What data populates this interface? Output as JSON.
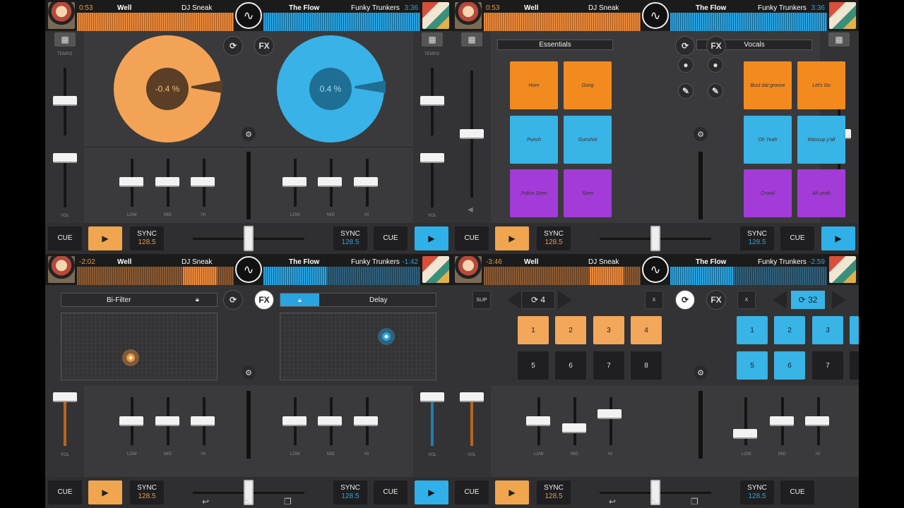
{
  "deck_a": {
    "title": "Well",
    "artist": "DJ Sneak"
  },
  "deck_b": {
    "title": "The Flow",
    "artist": "Funky Trunkers"
  },
  "screens": [
    {
      "left_time": "0:53",
      "right_time": "3:36",
      "left_pitch": "-0.4 %",
      "right_pitch": "0.4 %",
      "left_sync": "128.5",
      "right_sync": "128.5"
    },
    {
      "left_time": "0:53",
      "right_time": "3:36",
      "left_bank": "Essentials",
      "right_bank": "Vocals",
      "left_pads": [
        "Horn",
        "Gong",
        "Punch",
        "Gunshot",
        "Police Siren",
        "Siren"
      ],
      "right_pads": [
        "Bust dat groove",
        "Let's Go",
        "Oh Yeah",
        "Wassup y'all",
        "Crowd",
        "Ah yeah"
      ],
      "left_sync": "128.5",
      "right_sync": "128.5"
    },
    {
      "left_time": "-2:02",
      "right_time": "-1:42",
      "left_fx": "Bi-Filter",
      "right_fx": "Delay",
      "left_sync": "128.5",
      "right_sync": "128.5"
    },
    {
      "left_time": "-3:46",
      "right_time": "-2:59",
      "left_loop": "4",
      "right_loop": "32",
      "left_sync": "128.5",
      "right_sync": "128.5"
    }
  ],
  "labels": {
    "cue": "CUE",
    "sync": "SYNC",
    "fx": "FX",
    "slip": "SLIP",
    "x": "X",
    "tempo": "TEMPO",
    "vol": "VOL",
    "low": "LOW",
    "mid": "MID",
    "hi": "HI",
    "play": "▶"
  },
  "loop_pads": [
    "1",
    "2",
    "3",
    "4",
    "5",
    "6",
    "7",
    "8"
  ],
  "icons": [
    "sync-icon",
    "gear-icon",
    "grid-icon",
    "lock-icon",
    "mic-icon",
    "pen-icon",
    "speaker-icon",
    "back-icon",
    "home-icon",
    "recents-icon"
  ],
  "colors": {
    "deck_a": "#f0953d",
    "deck_b": "#2aa3e0",
    "vocal_purple": "#a33bd8"
  }
}
